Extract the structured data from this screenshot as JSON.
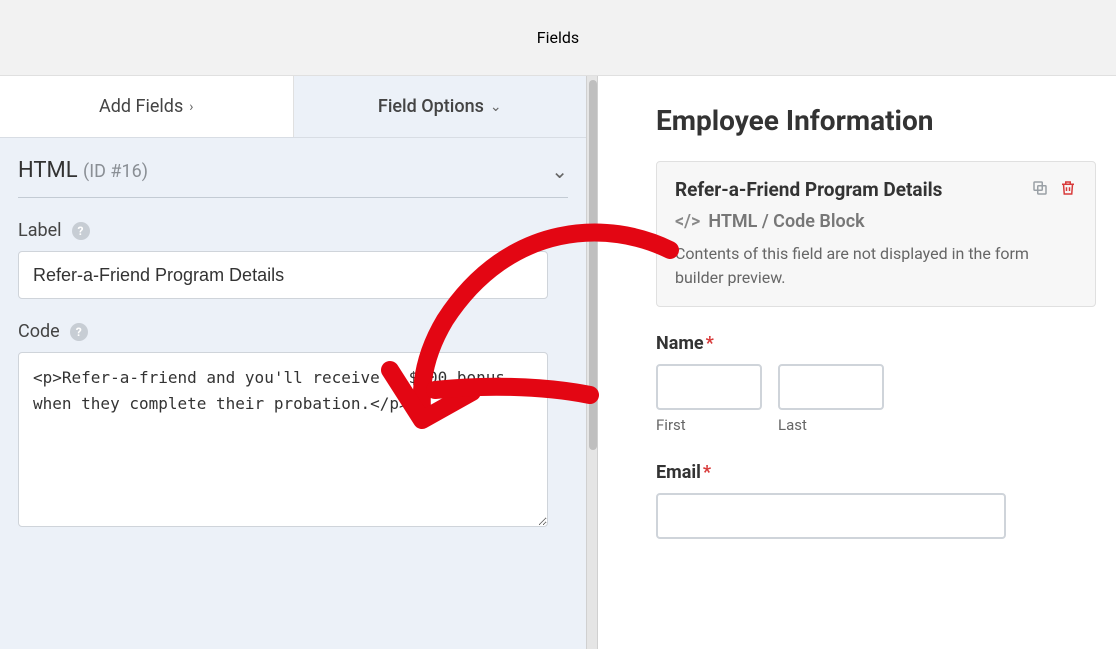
{
  "header": {
    "title": "Fields"
  },
  "tabs": {
    "add": "Add Fields",
    "options": "Field Options"
  },
  "section": {
    "type": "HTML",
    "id": "(ID #16)",
    "label_field_label": "Label",
    "label_value": "Refer-a-Friend Program Details",
    "code_field_label": "Code",
    "code_value": "<p>Refer-a-friend and you'll receive a $200 bonus when they complete their probation.</p>"
  },
  "preview": {
    "title": "Employee Information",
    "block": {
      "title": "Refer-a-Friend Program Details",
      "type": "HTML / Code Block",
      "desc": "Contents of this field are not displayed in the form builder preview."
    },
    "name_label": "Name",
    "first": "First",
    "last": "Last",
    "email_label": "Email"
  },
  "glyphs": {
    "asterisk": "*",
    "help": "?",
    "code": "</>"
  }
}
